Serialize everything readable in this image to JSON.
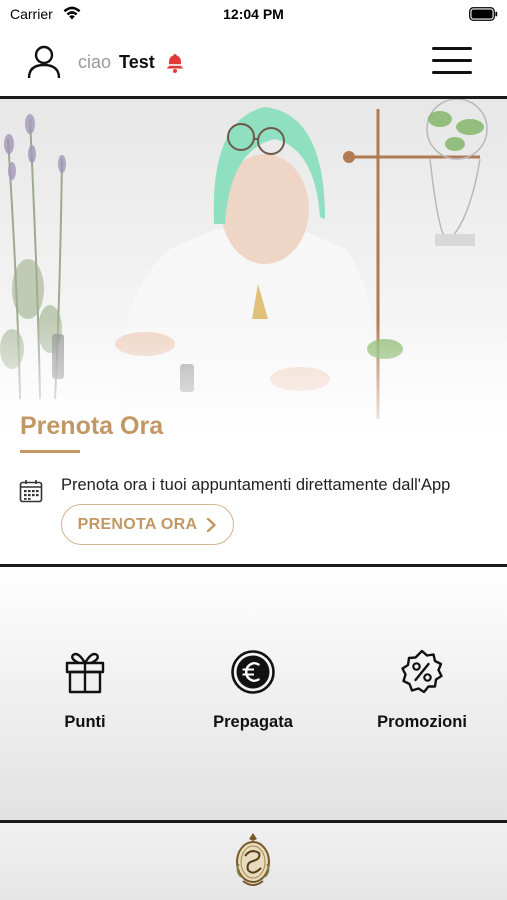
{
  "status_bar": {
    "carrier": "Carrier",
    "time": "12:04 PM"
  },
  "header": {
    "greeting_prefix": "ciao",
    "user_name": "Test"
  },
  "hero": {
    "title": "Prenota Ora",
    "description": "Prenota ora i tuoi appuntamenti direttamente dall'App",
    "button_label": "PRENOTA ORA"
  },
  "features": [
    {
      "label": "Punti",
      "icon": "gift-icon"
    },
    {
      "label": "Prepagata",
      "icon": "euro-icon"
    },
    {
      "label": "Promozioni",
      "icon": "discount-badge-icon"
    }
  ],
  "colors": {
    "accent": "#c29763",
    "alert": "#e03a36",
    "text": "#111111"
  }
}
